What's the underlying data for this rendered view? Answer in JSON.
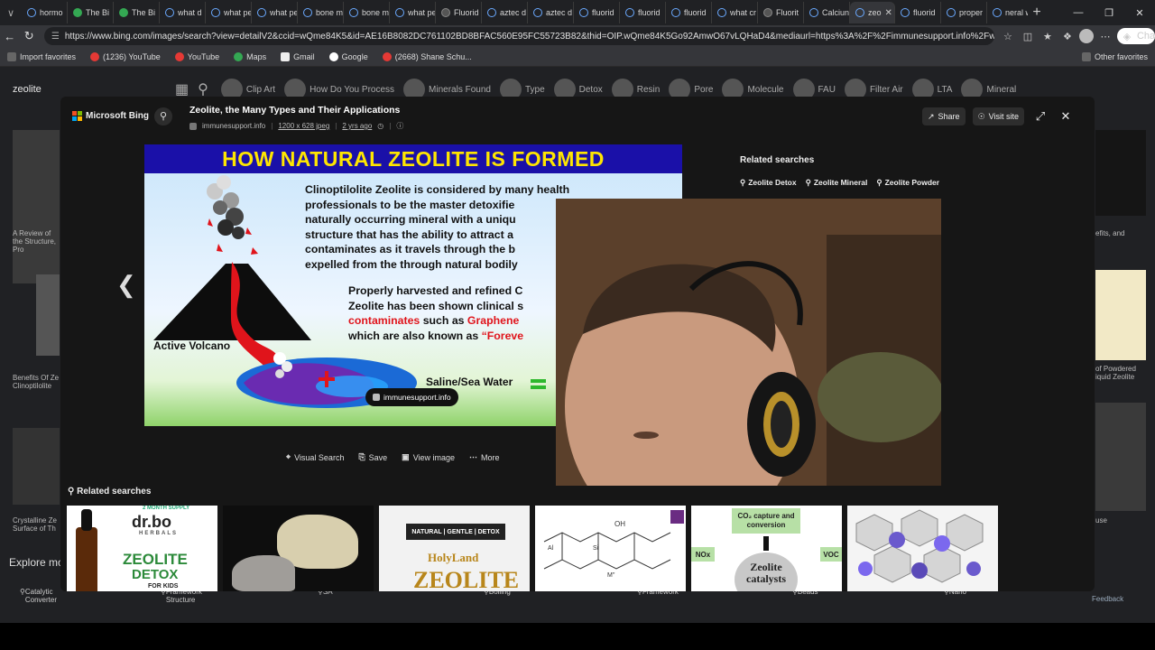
{
  "tabs": [
    {
      "label": "hormo",
      "fav": "search"
    },
    {
      "label": "The Bi",
      "fav": "green"
    },
    {
      "label": "The Bi",
      "fav": "green"
    },
    {
      "label": "what d",
      "fav": "search"
    },
    {
      "label": "what pe",
      "fav": "search"
    },
    {
      "label": "what pe",
      "fav": "search"
    },
    {
      "label": "bone m",
      "fav": "search"
    },
    {
      "label": "bone m",
      "fav": "search"
    },
    {
      "label": "what pe",
      "fav": "search"
    },
    {
      "label": "Fluorid",
      "fav": "box"
    },
    {
      "label": "aztec d",
      "fav": "search"
    },
    {
      "label": "aztec d",
      "fav": "search"
    },
    {
      "label": "fluorid",
      "fav": "search"
    },
    {
      "label": "fluorid",
      "fav": "search"
    },
    {
      "label": "fluorid",
      "fav": "search"
    },
    {
      "label": "what cr",
      "fav": "search"
    },
    {
      "label": "Fluorit",
      "fav": "box"
    },
    {
      "label": "Calciun",
      "fav": "search"
    },
    {
      "label": "zeo",
      "fav": "search",
      "active": true
    },
    {
      "label": "fluorid",
      "fav": "search"
    },
    {
      "label": "proper",
      "fav": "search"
    },
    {
      "label": "neral w",
      "fav": "search"
    }
  ],
  "address": {
    "url": "https://www.bing.com/images/search?view=detailV2&ccid=wQme84K5&id=AE16B8082DC761102BD8BFAC560E95FC55723B82&thid=OIP.wQme84K5Go92AmwO67vLQHaD4&mediaurl=https%3A%2F%2Fimmunesupport.info%2Fwp-content%2Fup..."
  },
  "copilot": {
    "label": "Chat"
  },
  "bookmarks": [
    {
      "label": "Import favorites",
      "icon": "bookmark-icon"
    },
    {
      "label": "(1236) YouTube",
      "icon": "youtube-icon"
    },
    {
      "label": "YouTube",
      "icon": "youtube-icon"
    },
    {
      "label": "Maps",
      "icon": "maps-icon"
    },
    {
      "label": "Gmail",
      "icon": "gmail-icon"
    },
    {
      "label": "Google",
      "icon": "google-icon"
    },
    {
      "label": "(2668) Shane Schu...",
      "icon": "youtube-icon"
    }
  ],
  "other_favorites": "Other favorites",
  "bing_query": "zeolite",
  "bing_chips": [
    "Clip Art",
    "How Do You Process",
    "Minerals Found",
    "Type",
    "Detox",
    "Resin",
    "Pore",
    "Molecule",
    "FAU",
    "Filter Air",
    "LTA",
    "Mineral"
  ],
  "bg_texts": {
    "left1": "A Review of the Structure, Pro",
    "left2": "Benefits Of Ze Clinoptilolite",
    "left3": "Crystalline Ze Surface of Th",
    "explore": "Explore mo",
    "right1": "efits, and",
    "right2": "of Powdered iquid Zeolite",
    "right3": "use"
  },
  "overlay": {
    "brand": "Microsoft Bing",
    "title": "Zeolite, the Many Types and Their Applications",
    "source": "immunesupport.info",
    "dims": "1200 x 628 jpeg",
    "age": "2 yrs ago",
    "share": "Share",
    "visit": "Visit site"
  },
  "image": {
    "headline": "HOW NATURAL ZEOLITE IS FORMED",
    "para1": "Clinoptilolite Zeolite is considered by many health\nprofessionals to be the master detoxifie\nnaturally occurring mineral with a uniqu\nstructure that has the ability to attract a\ncontaminates as it travels through the b\nexpelled from the through natural bodily",
    "para2a": "Properly harvested and refined C\nZeolite has been shown clinical s",
    "para2_red1": "contaminates",
    "para2_mid": " such as ",
    "para2_red2": "Graphene",
    "para2c": "which are also known as ",
    "para2_red3": "“Foreve",
    "volcano_label": "Active Volcano",
    "water_label": "Saline/Sea Water",
    "badge": "immunesupport.info"
  },
  "image_actions": [
    "Visual Search",
    "Save",
    "View image",
    "More"
  ],
  "related_side": {
    "title": "Related searches",
    "chips": [
      "Zeolite Detox",
      "Zeolite Mineral",
      "Zeolite Powder"
    ]
  },
  "related_bottom": {
    "title": "Related searches",
    "t1_brand": "dr.bo",
    "t1_sub": "HERBALS",
    "t1_tag": "2 MONTH SUPPLY",
    "t1_name": "ZEOLITE",
    "t1_name2": "DETOX",
    "t1_for": "FOR KIDS",
    "t3_tag": "NATURAL | GENTLE | DETOX",
    "t3_brand": "HolyLand",
    "t3_name": "ZEOLITE",
    "t4_oh": "OH",
    "t4_m": "M''",
    "t4_si": "Si",
    "t4_al": "Al",
    "t5_co2": "CO₂ capture and conversion",
    "t5_nox": "NOx",
    "t5_voc": "VOC",
    "t5_z": "Zeolite catalysts"
  },
  "bottom_chips": [
    "Catalytic Converter",
    "Framework Structure",
    "SA",
    "Boiling",
    "Framework",
    "Beads",
    "Nano"
  ],
  "feedback": "Feedback",
  "colors": {
    "accent": "#6aa9ff",
    "headline_bg": "#1a10a8",
    "headline_text": "#ffe600",
    "red": "#e0141b"
  }
}
